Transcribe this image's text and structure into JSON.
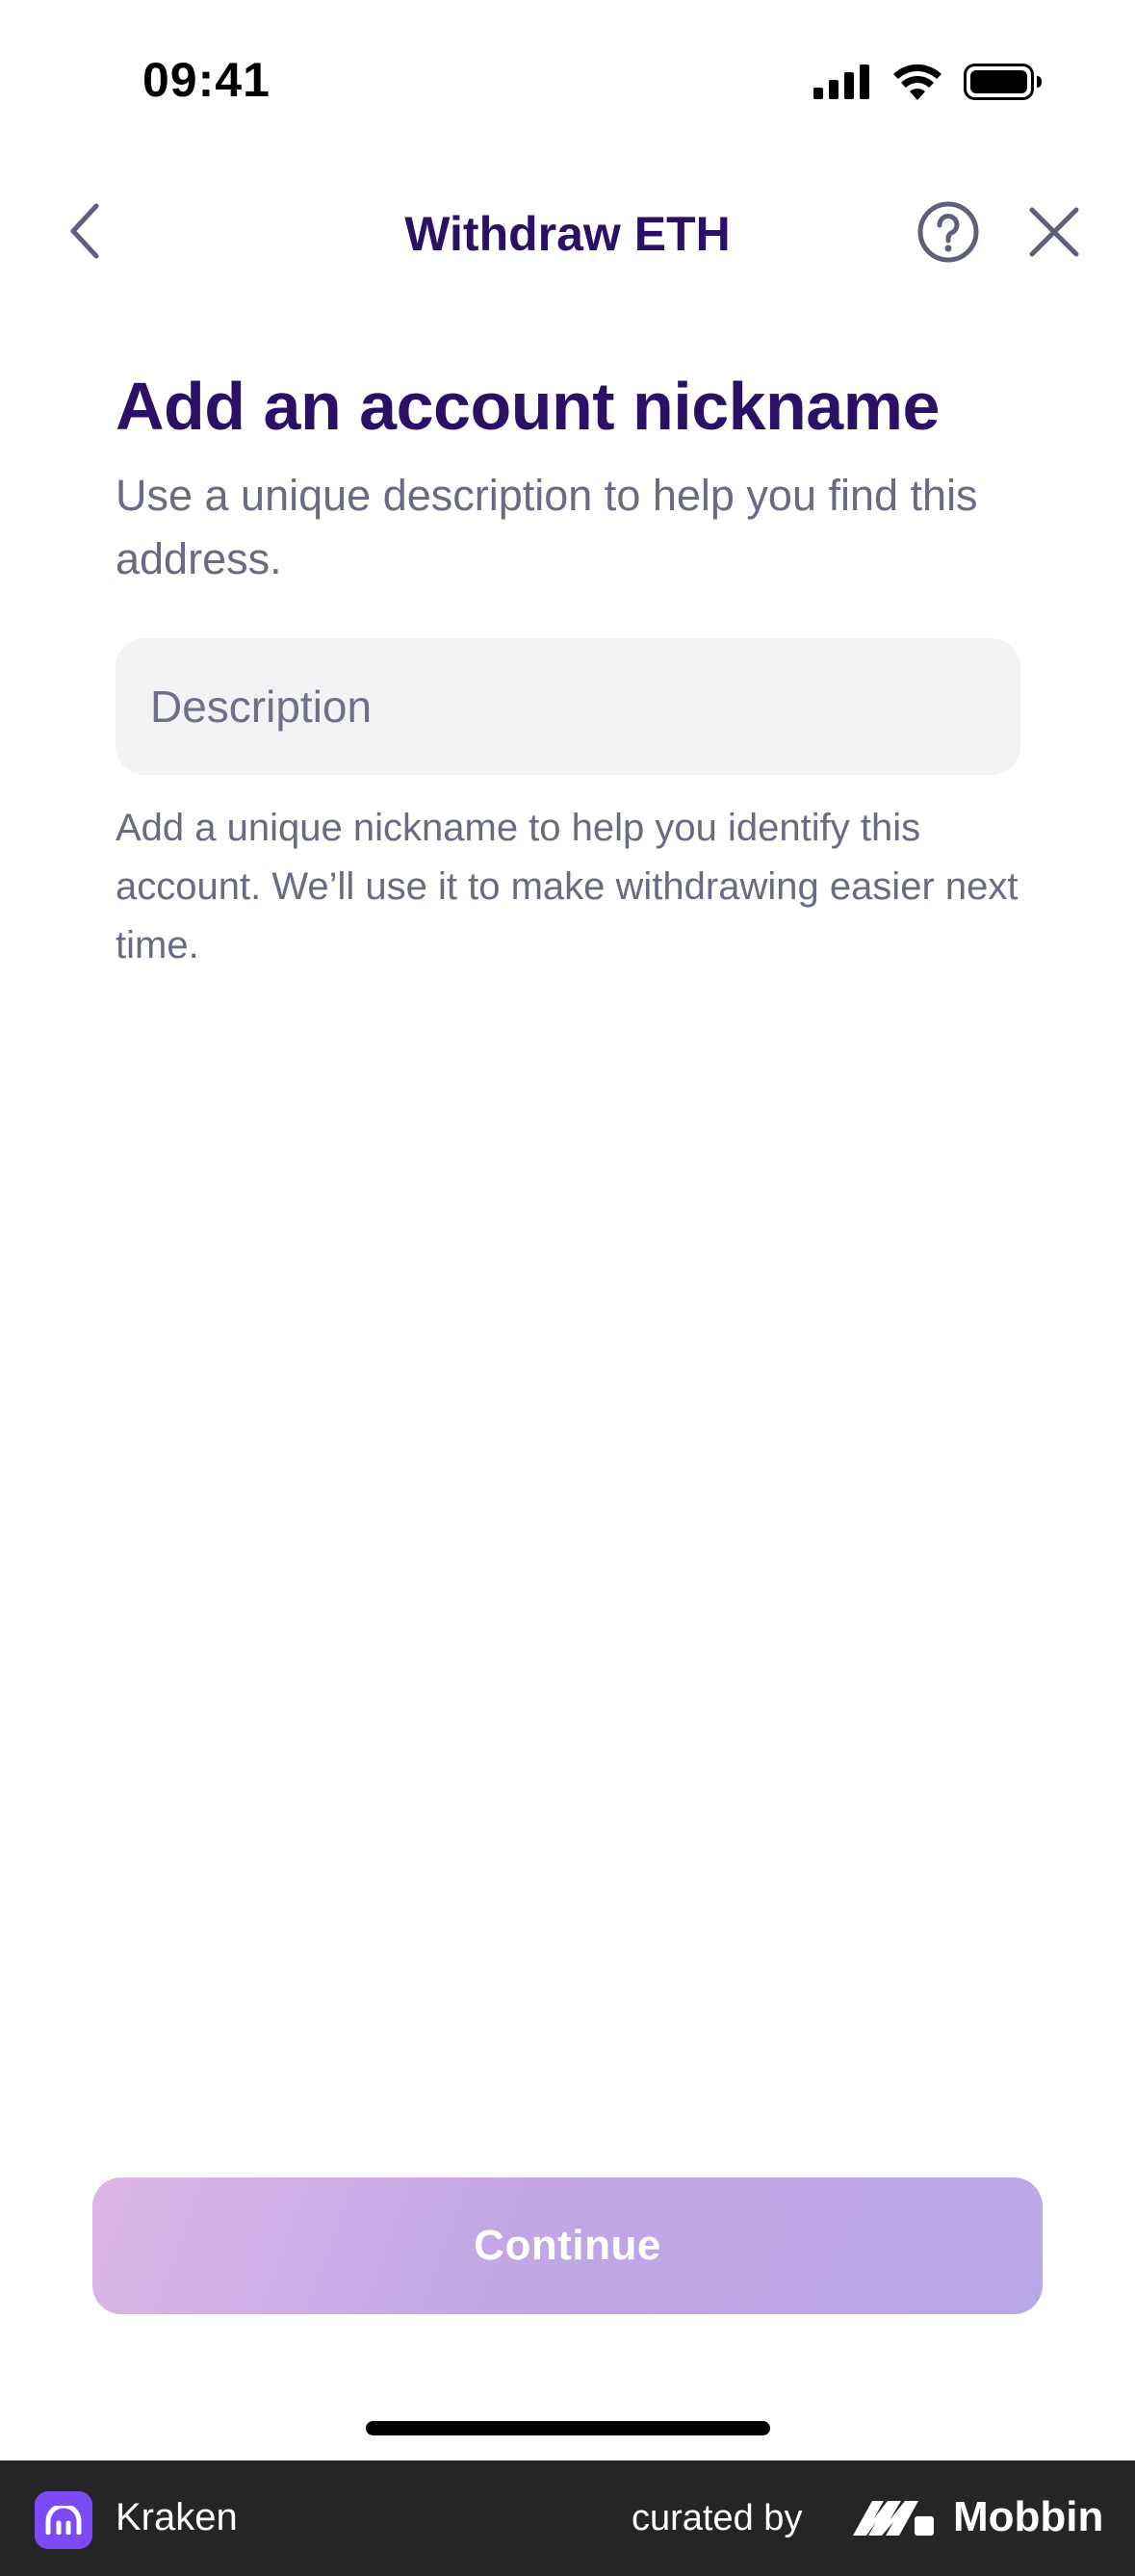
{
  "status_bar": {
    "time": "09:41",
    "icons": [
      "cellular-signal-icon",
      "wifi-icon",
      "battery-icon"
    ]
  },
  "nav": {
    "title": "Withdraw ETH",
    "back_icon": "chevron-left-icon",
    "help_icon": "question-circle-icon",
    "close_icon": "close-icon"
  },
  "content": {
    "heading": "Add an account nickname",
    "subheading": "Use a unique description to help you find this address.",
    "description_input": {
      "value": "",
      "placeholder": "Description"
    },
    "helper_text": "Add a unique nickname to help you identify this account. We’ll use it to make withdrawing easier next time."
  },
  "actions": {
    "continue_label": "Continue",
    "continue_enabled": false
  },
  "footer": {
    "app_name": "Kraken",
    "curated_label": "curated by",
    "brand": "Mobbin"
  },
  "colors": {
    "title": "#2b1166",
    "body_text": "#686b82",
    "input_bg": "#f3f3f5",
    "button_gradient": [
      "#dcb6e6",
      "#b9a8e9"
    ],
    "footer_bg": "#252525",
    "kraken_purple": "#7b4cf6"
  }
}
